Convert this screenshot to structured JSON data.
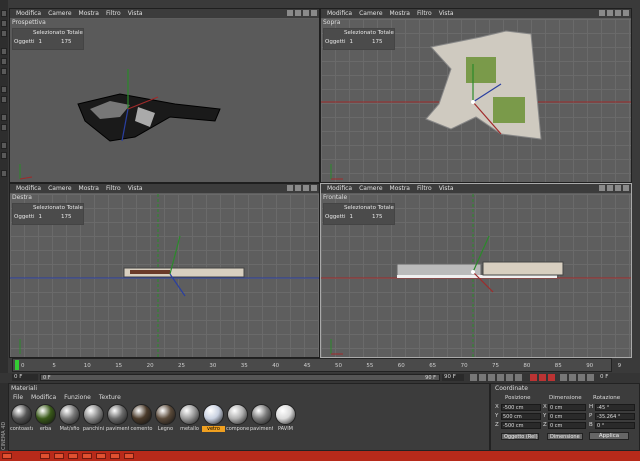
{
  "menus": {
    "viewport_menu": [
      "Modifica",
      "Camere",
      "Mostra",
      "Filtro",
      "Vista"
    ]
  },
  "viewports": {
    "perspective": {
      "name": "Prospettiva"
    },
    "top": {
      "name": "Sopra"
    },
    "right": {
      "name": "Destra"
    },
    "front": {
      "name": "Frontale"
    }
  },
  "hud": {
    "header": "Selezionato Totale",
    "label": "Oggetti",
    "selected": "1",
    "total": "175"
  },
  "timeline": {
    "ticks": [
      "0",
      "5",
      "10",
      "15",
      "20",
      "25",
      "30",
      "35",
      "40",
      "45",
      "50",
      "55",
      "60",
      "65",
      "70",
      "75",
      "80",
      "85",
      "90",
      "9"
    ],
    "current_frame": "0 F",
    "start": "0 F",
    "end_left": "90 F",
    "end_right": "90 F",
    "frame_right": "0 F"
  },
  "materials": {
    "title": "Materiali",
    "menu": [
      "File",
      "Modifica",
      "Funzione",
      "Texture"
    ],
    "items": [
      {
        "label": "contoasta",
        "color": "#555555",
        "selected": false
      },
      {
        "label": "erba",
        "color": "#3a5a1a",
        "selected": false
      },
      {
        "label": "Mat/sfio",
        "color": "#777777",
        "selected": false
      },
      {
        "label": "panchini",
        "color": "#8a8a8a",
        "selected": false
      },
      {
        "label": "paviment",
        "color": "#6a6a6a",
        "selected": false
      },
      {
        "label": "cemento",
        "color": "#4a3a2a",
        "selected": false
      },
      {
        "label": "Legno",
        "color": "#5a4a3a",
        "selected": false
      },
      {
        "label": "metallo",
        "color": "#9a9a9a",
        "selected": false
      },
      {
        "label": "vetro",
        "color": "#c8d0e0",
        "selected": true
      },
      {
        "label": "compone",
        "color": "#b0b0b0",
        "selected": false
      },
      {
        "label": "paviment",
        "color": "#7a7a7a",
        "selected": false
      },
      {
        "label": "PAVIM",
        "color": "#dadada",
        "selected": false
      }
    ]
  },
  "coordinates": {
    "title": "Coordinate",
    "col_pos": "Posizione",
    "col_dim": "Dimensione",
    "col_rot": "Rotazione",
    "rows": [
      {
        "axis": "X",
        "pos": "-500 cm",
        "dim": "0 cm",
        "rot_label": "H",
        "rot": "-45 °"
      },
      {
        "axis": "Y",
        "pos": "500 cm",
        "dim": "0 cm",
        "rot_label": "P",
        "rot": "-35.264 °"
      },
      {
        "axis": "Z",
        "pos": "-500 cm",
        "dim": "0 cm",
        "rot_label": "B",
        "rot": "0 °"
      }
    ],
    "dropdown_obj": "Oggetto (Rel)",
    "dropdown_dim": "Dimensione",
    "apply": "Applica"
  },
  "app": {
    "logo_text": "CINEMA 4D"
  },
  "colors": {
    "x_axis": "#a02a2a",
    "y_axis": "#2a8a2a",
    "z_axis": "#2a3fa0",
    "selected_material": "#f0a020",
    "taskbar": "#b82a1a"
  }
}
